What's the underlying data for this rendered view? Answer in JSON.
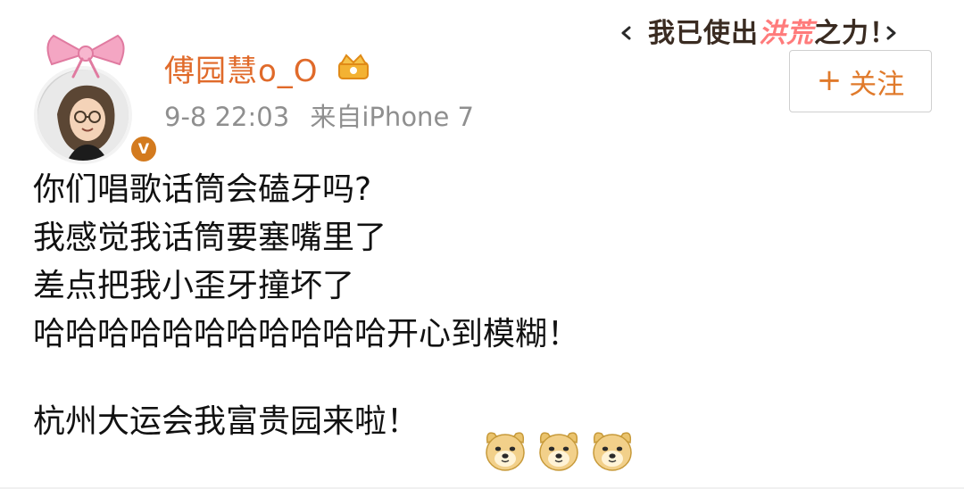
{
  "header": {
    "username": "傅园慧o_O",
    "timestamp": "9-8 22:03",
    "source": "来自iPhone 7",
    "badge_letter": "V"
  },
  "banner": {
    "text_part1": "我已使出",
    "text_part2": "洪荒",
    "text_part3": "之力！"
  },
  "actions": {
    "follow_plus": "+",
    "follow_label": "关注"
  },
  "post": {
    "lines": [
      "你们唱歌话筒会磕牙吗?",
      "我感觉我话筒要塞嘴里了",
      "差点把我小歪牙撞坏了",
      "哈哈哈哈哈哈哈哈哈哈哈开心到模糊！",
      "杭州大运会我富贵园来啦！"
    ]
  },
  "colors": {
    "username": "#e06a2a",
    "meta": "#8f8f8f",
    "follow": "#e07a2b",
    "verified": "#d37a1e"
  },
  "icons": {
    "crown": "crown-icon",
    "doge": "doge-emoji"
  }
}
